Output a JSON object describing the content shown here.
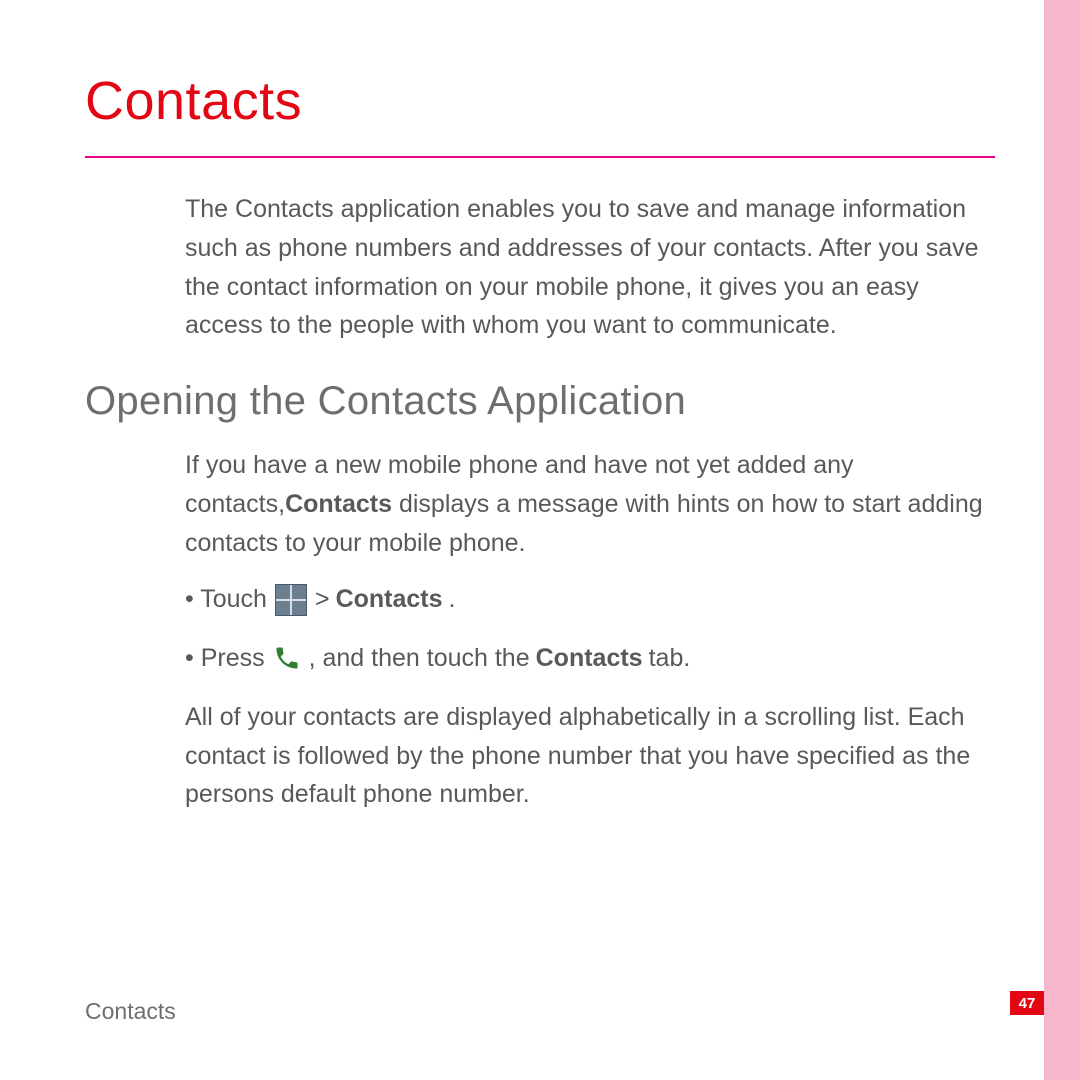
{
  "chapter": {
    "title": "Contacts"
  },
  "intro": {
    "p1": "The Contacts application enables you to save and manage information such as phone numbers and addresses of your contacts. After you save the contact information on your mobile phone, it gives you an easy access to the people with whom you want to communicate."
  },
  "section1": {
    "title": "Opening the Contacts Application",
    "p1a": "If you have a new mobile phone and have not yet added any contacts,",
    "p1b": "Contacts",
    "p1c": " displays a message with hints on how to start adding contacts to your mobile phone.",
    "bullet1_pre": "• Touch ",
    "bullet1_sep": " > ",
    "bullet1_bold": "Contacts",
    "bullet1_post": ".",
    "bullet2_pre": "• Press ",
    "bullet2_mid": " , and then touch the ",
    "bullet2_bold": "Contacts",
    "bullet2_post": " tab.",
    "p2": "All of your contacts are displayed alphabetically in a scrolling list. Each contact is followed by the phone number that you have specified as the persons default phone number."
  },
  "footer": {
    "chapter_label": "Contacts",
    "page_number": "47"
  },
  "icons": {
    "apps": "apps-grid-icon",
    "phone": "phone-handset-icon"
  }
}
